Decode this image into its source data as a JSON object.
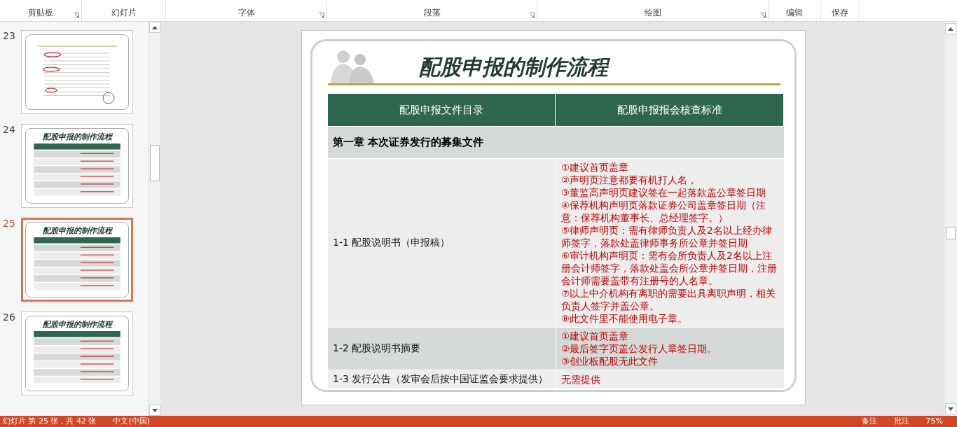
{
  "ribbon": {
    "groups": [
      {
        "label": "剪贴板",
        "launcher": true
      },
      {
        "label": "幻灯片",
        "launcher": false
      },
      {
        "label": "字体",
        "launcher": true
      },
      {
        "label": "段落",
        "launcher": true
      },
      {
        "label": "绘图",
        "launcher": true
      },
      {
        "label": "编辑",
        "launcher": false
      },
      {
        "label": "保存",
        "launcher": false
      }
    ]
  },
  "thumbnails": [
    {
      "number": "23",
      "selected": false,
      "kind": "scan"
    },
    {
      "number": "24",
      "selected": false,
      "kind": "table",
      "title": "配股申报的制作流程"
    },
    {
      "number": "25",
      "selected": true,
      "kind": "table",
      "title": "配股申报的制作流程"
    },
    {
      "number": "26",
      "selected": false,
      "kind": "table",
      "title": "配股申报的制作流程"
    }
  ],
  "slide": {
    "title": "配股申报的制作流程",
    "table": {
      "columns": [
        "配股申报文件目录",
        "配股申报报会核查标准"
      ],
      "rows": [
        {
          "kind": "chapter",
          "label": "第一章 本次证券发行的募集文件"
        },
        {
          "kind": "item",
          "label": "1-1 配股说明书（申报稿）",
          "notes": [
            "①建议首页盖章",
            "②声明页注意都要有机打人名，",
            "③董监高声明页建议签在一起落款盖公章签日期",
            "④保荐机构声明页落款证券公司盖章签日期（注意：保荐机构董事长、总经理签字。）",
            "⑤律师声明页：需有律师负责人及2名以上经办律师签字，落款处盖律师事务所公章并签日期",
            "⑥审计机构声明页：需有会所负责人及2名以上注册会计师签字，落款处盖会所公章并签日期，注册会计师需要盖带有注册号的人名章。",
            "⑦以上中介机构有离职的需要出具离职声明，相关负责人签字并盖公章。",
            "⑧此文件里不能使用电子章。"
          ]
        },
        {
          "kind": "item",
          "label": "1-2 配股说明书摘要",
          "notes": [
            "①建议首页盖章",
            "②最后签字页盖公发行人章签日期。",
            "③创业板配股无此文件"
          ]
        },
        {
          "kind": "item",
          "label": "1-3 发行公告（发审会后按中国证监会要求提供）",
          "notes": [
            "无需提供"
          ]
        }
      ]
    }
  },
  "status_bar": {
    "slide_info": "幻灯片 第 25 张，共 42 张",
    "language": "中文(中国)",
    "notes_button": "备注",
    "comments_button": "批注",
    "zoom": "75%"
  }
}
